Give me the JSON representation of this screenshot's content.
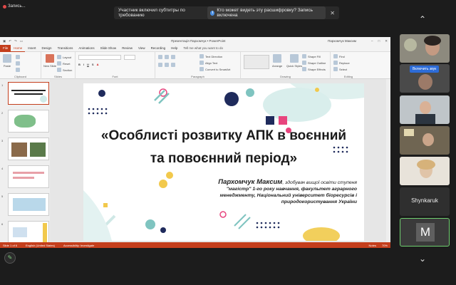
{
  "meeting": {
    "recording_label": "Запись...",
    "notification_text": "Участник включил субтитры по требованию",
    "notification_info": "Кто может видеть эту расшифровку? Запись включена",
    "close_glyph": "✕"
  },
  "powerpoint": {
    "window_title": "Презентація Пархомчук • PowerPoint",
    "user_name": "Пархомчук Максим",
    "tabs": [
      "File",
      "Home",
      "Insert",
      "Design",
      "Transitions",
      "Animations",
      "Slide Show",
      "Review",
      "View",
      "Recording",
      "Help"
    ],
    "active_tab": "Home",
    "tell_me": "Tell me what you want to do",
    "ribbon_groups": {
      "clipboard": "Clipboard",
      "slides": "Slides",
      "font": "Font",
      "paragraph": "Paragraph",
      "drawing": "Drawing",
      "editing": "Editing"
    },
    "ribbon_buttons": {
      "paste": "Paste",
      "new_slide": "New Slide",
      "layout": "Layout",
      "reset": "Reset",
      "section": "Section",
      "text_direction": "Text Direction",
      "align_text": "Align Text",
      "convert_smartart": "Convert to SmartArt",
      "arrange": "Arrange",
      "quick_styles": "Quick Styles",
      "shape_fill": "Shape Fill",
      "shape_outline": "Shape Outline",
      "shape_effects": "Shape Effects",
      "find": "Find",
      "replace": "Replace",
      "select": "Select"
    },
    "slide_numbers": [
      "1",
      "2",
      "3",
      "4",
      "5",
      "6"
    ],
    "slide": {
      "title_line1": "«Особлисті розвитку АПК в воєнний",
      "title_line2": "та повоєнний період»",
      "author_name": "Пархомчук Максим",
      "author_rest1": ", здобувач вищої освіти ступеня",
      "author_line2": "\"магістр\" 1-го року навчання, факультет аграрного",
      "author_line3": "менеджменту, Національний університет біоресурсів і",
      "author_line4": "природокористування України"
    },
    "status": {
      "slide_info": "Slide 1 of 6",
      "language": "English (United States)",
      "accessibility": "Accessibility: Investigate",
      "notes": "Notes",
      "zoom": "70%"
    }
  },
  "participants": {
    "enable_sound_label": "Включить звук",
    "name_tile": "Shynkaruk",
    "avatar_letter": "M"
  },
  "colors": {
    "accent": "#c43e1c",
    "navy": "#1f2b5c",
    "teal": "#7fc4c0",
    "yellow": "#f2c94c",
    "pink": "#e8457e"
  }
}
